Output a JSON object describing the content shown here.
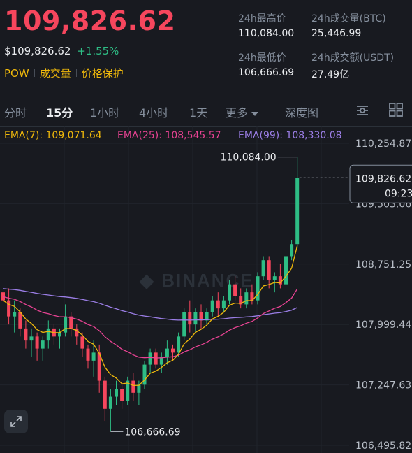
{
  "header": {
    "last_price": "109,826.62",
    "usd_price": "$109,826.62",
    "change_pct": "+1.55%",
    "tags": [
      "POW",
      "成交量",
      "价格保护"
    ]
  },
  "stats": {
    "high_label": "24h最高价",
    "high_value": "110,084.00",
    "vol_btc_label": "24h成交量(BTC)",
    "vol_btc_value": "25,446.99",
    "low_label": "24h最低价",
    "low_value": "106,666.69",
    "vol_usdt_label": "24h成交额(USDT)",
    "vol_usdt_value": "27.49亿"
  },
  "tabs": [
    "分时",
    "15分",
    "1小时",
    "4小时",
    "1天",
    "更多",
    "深度图"
  ],
  "active_tab": "15分",
  "icons": [
    "indicator-settings-icon",
    "layout-grid-icon",
    "expand-icon"
  ],
  "indicators": {
    "ema7": "EMA(7): 109,071.64",
    "ema25": "EMA(25): 108,545.57",
    "ema99": "EMA(99): 108,330.08"
  },
  "colors": {
    "up": "#2ebd85",
    "down": "#f6465d",
    "ema7": "#f0b90b",
    "ema25": "#e84393",
    "ema99": "#9b7ee6",
    "accent": "#f0b90b"
  },
  "chart_data": {
    "type": "candlestick",
    "y_ticks": [
      "110,254.87",
      "109,503.06",
      "108,751.25",
      "107,999.44",
      "107,247.63",
      "106,495.82"
    ],
    "ylim": [
      106495.82,
      110254.87
    ],
    "high_marker": "110,084.00",
    "low_marker": "106,666.69",
    "current_price": "109,826.62",
    "countdown": "09:23",
    "watermark": "BINANCE",
    "candles": [
      [
        108400,
        108500,
        108150,
        108300
      ],
      [
        108300,
        108450,
        108000,
        108100
      ],
      [
        108100,
        108300,
        107900,
        108150
      ],
      [
        108150,
        108200,
        107850,
        107950
      ],
      [
        107950,
        108050,
        107700,
        107800
      ],
      [
        107800,
        107950,
        107600,
        107850
      ],
      [
        107850,
        107900,
        107550,
        107700
      ],
      [
        107700,
        107850,
        107550,
        107800
      ],
      [
        107800,
        108050,
        107700,
        107950
      ],
      [
        107950,
        108000,
        107750,
        107850
      ],
      [
        107850,
        107950,
        107700,
        107900
      ],
      [
        107900,
        108250,
        107850,
        108100
      ],
      [
        108100,
        108150,
        107850,
        107950
      ],
      [
        107950,
        108000,
        107750,
        107850
      ],
      [
        107850,
        107900,
        107600,
        107700
      ],
      [
        107700,
        107750,
        107450,
        107550
      ],
      [
        107550,
        107800,
        107350,
        107650
      ],
      [
        107650,
        107750,
        107150,
        107300
      ],
      [
        107300,
        107350,
        106800,
        106950
      ],
      [
        106950,
        107200,
        106667,
        107100
      ],
      [
        107100,
        107300,
        107000,
        107200
      ],
      [
        107200,
        107250,
        106950,
        107050
      ],
      [
        107050,
        107350,
        107000,
        107300
      ],
      [
        107300,
        107400,
        107050,
        107150
      ],
      [
        107150,
        107300,
        107000,
        107250
      ],
      [
        107250,
        107550,
        107200,
        107500
      ],
      [
        107500,
        107700,
        107400,
        107650
      ],
      [
        107650,
        107700,
        107450,
        107500
      ],
      [
        107500,
        107650,
        107400,
        107600
      ],
      [
        107600,
        107800,
        107500,
        107700
      ],
      [
        107700,
        107750,
        107550,
        107650
      ],
      [
        107650,
        107900,
        107600,
        107850
      ],
      [
        107850,
        108200,
        107800,
        108150
      ],
      [
        108150,
        108300,
        107900,
        108000
      ],
      [
        108000,
        108200,
        107900,
        108150
      ],
      [
        108150,
        108250,
        107950,
        108050
      ],
      [
        108050,
        108200,
        108000,
        108150
      ],
      [
        108150,
        108350,
        108100,
        108300
      ],
      [
        108300,
        108400,
        108100,
        108200
      ],
      [
        108200,
        108350,
        108150,
        108300
      ],
      [
        108300,
        108550,
        108250,
        108500
      ],
      [
        108500,
        108600,
        108300,
        108350
      ],
      [
        108350,
        108450,
        108200,
        108250
      ],
      [
        108250,
        108450,
        108200,
        108400
      ],
      [
        108400,
        108500,
        108250,
        108300
      ],
      [
        108300,
        108650,
        108250,
        108600
      ],
      [
        108600,
        108850,
        108550,
        108800
      ],
      [
        108800,
        108850,
        108450,
        108550
      ],
      [
        108550,
        108650,
        108400,
        108600
      ],
      [
        108600,
        108750,
        108450,
        108500
      ],
      [
        108500,
        108900,
        108450,
        108850
      ],
      [
        108850,
        109050,
        108800,
        109000
      ],
      [
        109000,
        110084,
        108950,
        109826
      ]
    ]
  }
}
